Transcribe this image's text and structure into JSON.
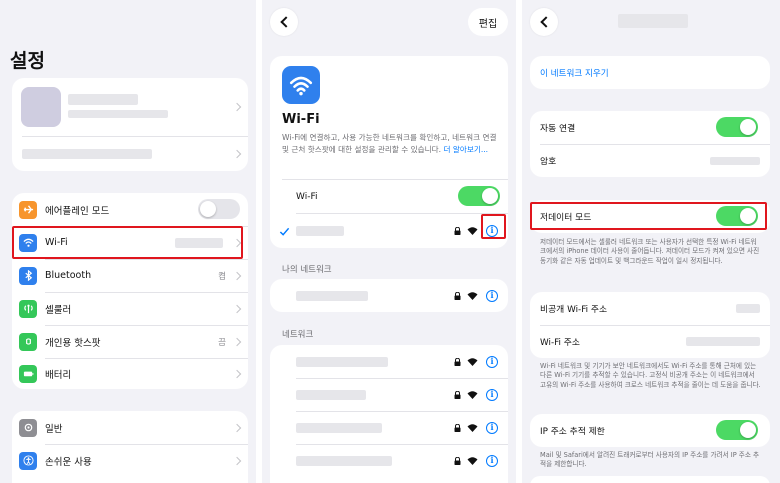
{
  "settings": {
    "title": "설정",
    "airplane_label": "에어플레인 모드",
    "wifi_label": "Wi-Fi",
    "bluetooth_label": "Bluetooth",
    "bluetooth_value": "켬",
    "cellular_label": "셀룰러",
    "hotspot_label": "개인용 핫스팟",
    "hotspot_value": "끔",
    "battery_label": "배터리",
    "general_label": "일반",
    "accessibility_label": "손쉬운 사용"
  },
  "wifi": {
    "edit_label": "편집",
    "title": "Wi-Fi",
    "description": "Wi-Fi에 연결하고, 사용 가능한 네트워크를 확인하고, 네트워크 연결 및 근처 핫스팟에 대한 설정을 관리할 수 있습니다.",
    "learn_more": "더 알아보기...",
    "toggle_label": "Wi-Fi",
    "my_networks_header": "나의 네트워크",
    "networks_header": "네트워크"
  },
  "details": {
    "forget_label": "이 네트워크 지우기",
    "auto_join_label": "자동 연결",
    "password_label": "암호",
    "low_data_label": "저데이터 모드",
    "low_data_footer": "저데이터 모드에서는 셀룰러 네트워크 또는 사용자가 선택한 특정 Wi-Fi 네트워크에서의 iPhone 데이터 사용이 줄어듭니다. 저데이터 모드가 켜져 있으면 사진 동기화 같은 자동 업데이트 및 백그라운드 작업이 일시 정지됩니다.",
    "private_addr_label": "비공개 Wi-Fi 주소",
    "wifi_addr_label": "Wi-Fi 주소",
    "addr_footer": "Wi-Fi 네트워크 및 기기가 보안 네트워크에서도 Wi-Fi 주소를 통해 근처에 있는 다른 Wi-Fi 기기를 추적할 수 있습니다. 고정식 비공개 주소는 이 네트워크에서 고유의 Wi-Fi 주소를 사용하여 크로스 네트워크 추적을 줄이는 데 도움을 줍니다.",
    "ip_tracking_label": "IP 주소 추적 제한",
    "ip_tracking_footer": "Mail 및 Safari에서 알려진 트래커로부터 사용자의 IP 주소를 가려서 IP 주소 추적을 제한합니다."
  },
  "colors": {
    "accent": "#007aff",
    "toggle_on": "#4cd964",
    "highlight": "#e0161e",
    "background": "#f2f2f7"
  },
  "icons": [
    "airplane-icon",
    "wifi-icon",
    "bluetooth-icon",
    "cellular-icon",
    "hotspot-icon",
    "battery-icon",
    "gear-icon",
    "accessibility-icon",
    "lock-icon",
    "info-icon",
    "checkmark-icon",
    "chevron-left-icon"
  ]
}
